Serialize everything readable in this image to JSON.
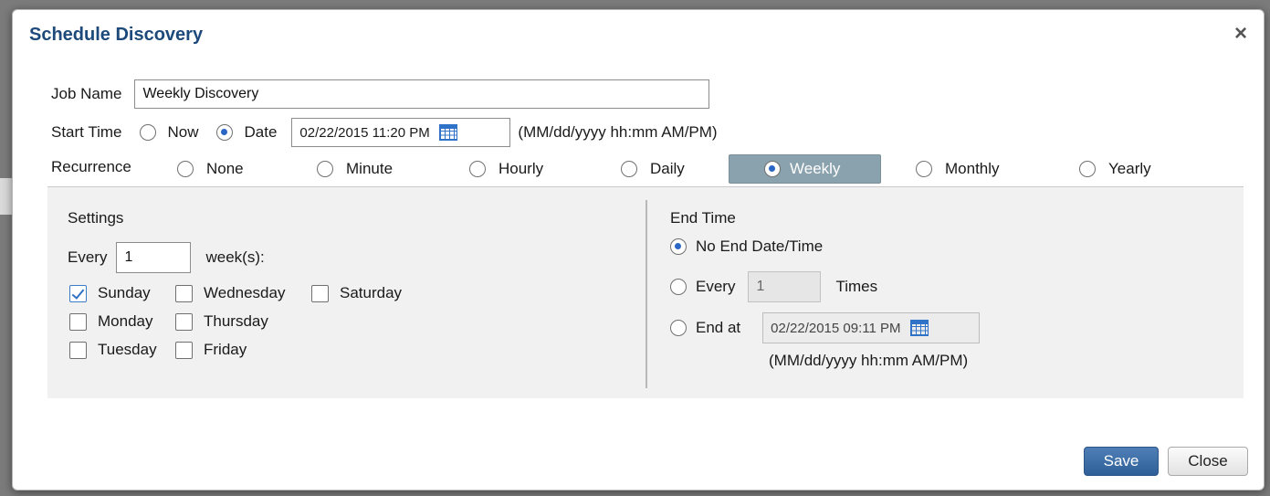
{
  "dialog": {
    "title": "Schedule Discovery",
    "close_glyph": "×"
  },
  "job_name": {
    "label": "Job Name",
    "value": "Weekly Discovery"
  },
  "start_time": {
    "label": "Start Time",
    "option_now": "Now",
    "option_date": "Date",
    "selected": "Date",
    "date_value": "02/22/2015 11:20 PM",
    "format_hint": "(MM/dd/yyyy hh:mm AM/PM)"
  },
  "recurrence": {
    "label": "Recurrence",
    "options": [
      "None",
      "Minute",
      "Hourly",
      "Daily",
      "Weekly",
      "Monthly",
      "Yearly"
    ],
    "selected": "Weekly"
  },
  "settings": {
    "heading": "Settings",
    "every_label": "Every",
    "every_value": "1",
    "unit_label": "week(s):",
    "days": {
      "sunday": "Sunday",
      "monday": "Monday",
      "tuesday": "Tuesday",
      "wednesday": "Wednesday",
      "thursday": "Thursday",
      "friday": "Friday",
      "saturday": "Saturday"
    },
    "checked_days": [
      "Sunday"
    ]
  },
  "end_time": {
    "heading": "End Time",
    "option_no_end": "No End Date/Time",
    "option_every": "Every",
    "every_value": "1",
    "times_label": "Times",
    "option_end_at": "End at",
    "end_at_value": "02/22/2015 09:11 PM",
    "format_hint": "(MM/dd/yyyy hh:mm AM/PM)",
    "selected": "No End Date/Time"
  },
  "buttons": {
    "save": "Save",
    "close": "Close"
  },
  "colors": {
    "title": "#1d4a7a",
    "selected_pill": "#8aa2ad",
    "save_button": "#2e5f98",
    "radio_dot": "#2a66c6"
  },
  "icons": [
    "close-icon",
    "calendar-icon"
  ]
}
